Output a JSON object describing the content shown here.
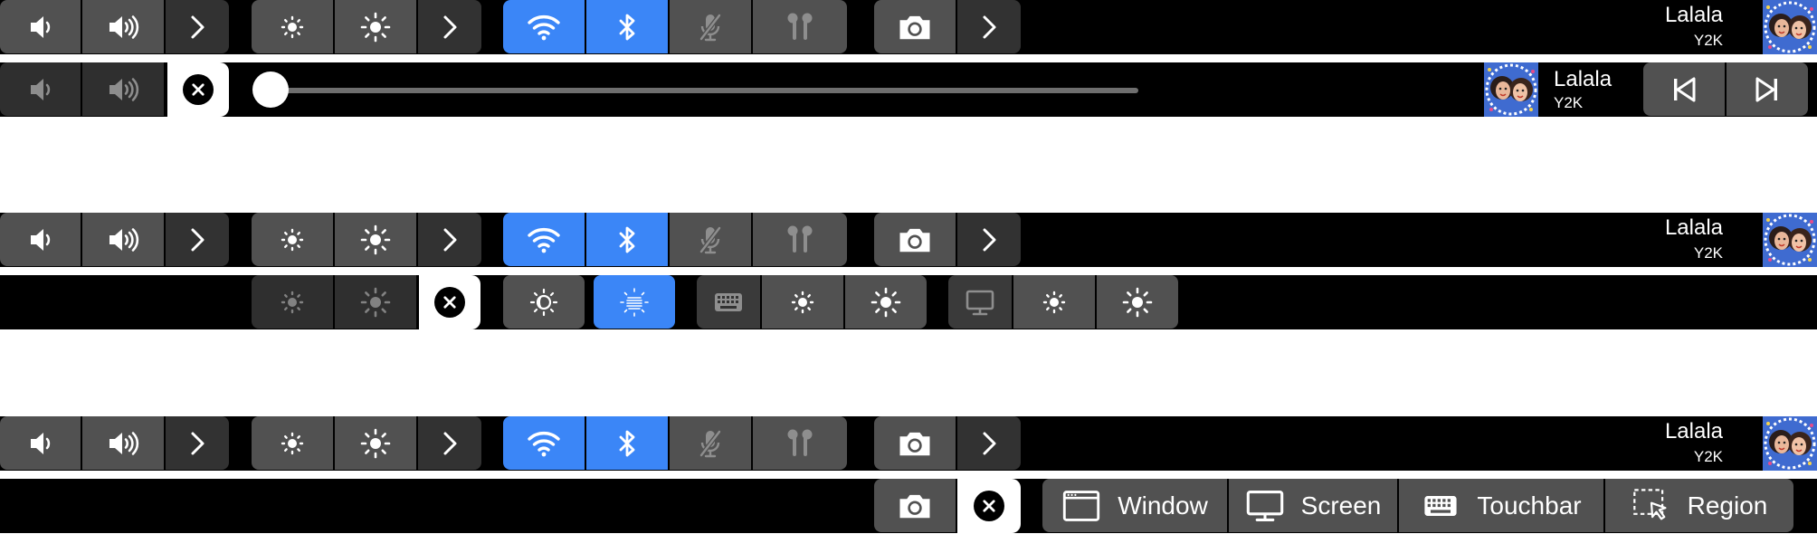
{
  "now_playing": {
    "title": "Lalala",
    "artist": "Y2K"
  },
  "screenshot": {
    "window_label": "Window",
    "screen_label": "Screen",
    "touchbar_label": "Touchbar",
    "region_label": "Region"
  },
  "colors": {
    "accent": "#3b86f7",
    "button": "#515151",
    "button_dim": "#323232",
    "bar": "#000000"
  },
  "icons": [
    "volume-down-icon",
    "volume-up-icon",
    "chevron-right-icon",
    "brightness-down-icon",
    "brightness-up-icon",
    "wifi-icon",
    "bluetooth-icon",
    "mic-muted-icon",
    "airpods-icon",
    "camera-icon",
    "close-icon",
    "previous-track-icon",
    "next-track-icon",
    "night-shift-icon",
    "true-tone-icon",
    "keyboard-icon",
    "monitor-icon",
    "window-icon",
    "region-icon",
    "avatar"
  ],
  "media": {
    "progress": 0
  }
}
